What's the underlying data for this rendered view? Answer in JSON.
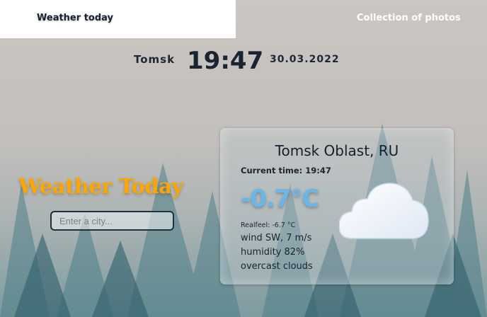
{
  "nav": {
    "weather_today": "Weather today",
    "collection": "Collection of photos"
  },
  "clock": {
    "city": "Tomsk",
    "time": "19:47",
    "date": "30.03.2022"
  },
  "brand": {
    "title": "Weather Today"
  },
  "search": {
    "placeholder": "Enter a city...",
    "value": ""
  },
  "card": {
    "location": "Tomsk Oblast, RU",
    "current_time": "Current time: 19:47",
    "temperature": "-0.7°C",
    "realfeel": "Realfeel: -6.7 °C",
    "wind": "wind SW, 7 m/s",
    "humidity": "humidity 82%",
    "description": "overcast clouds",
    "icon": "cloud-icon"
  },
  "colors": {
    "brand": "#ffa500",
    "temperature": "#6ab6e8",
    "text": "#1b2330"
  }
}
